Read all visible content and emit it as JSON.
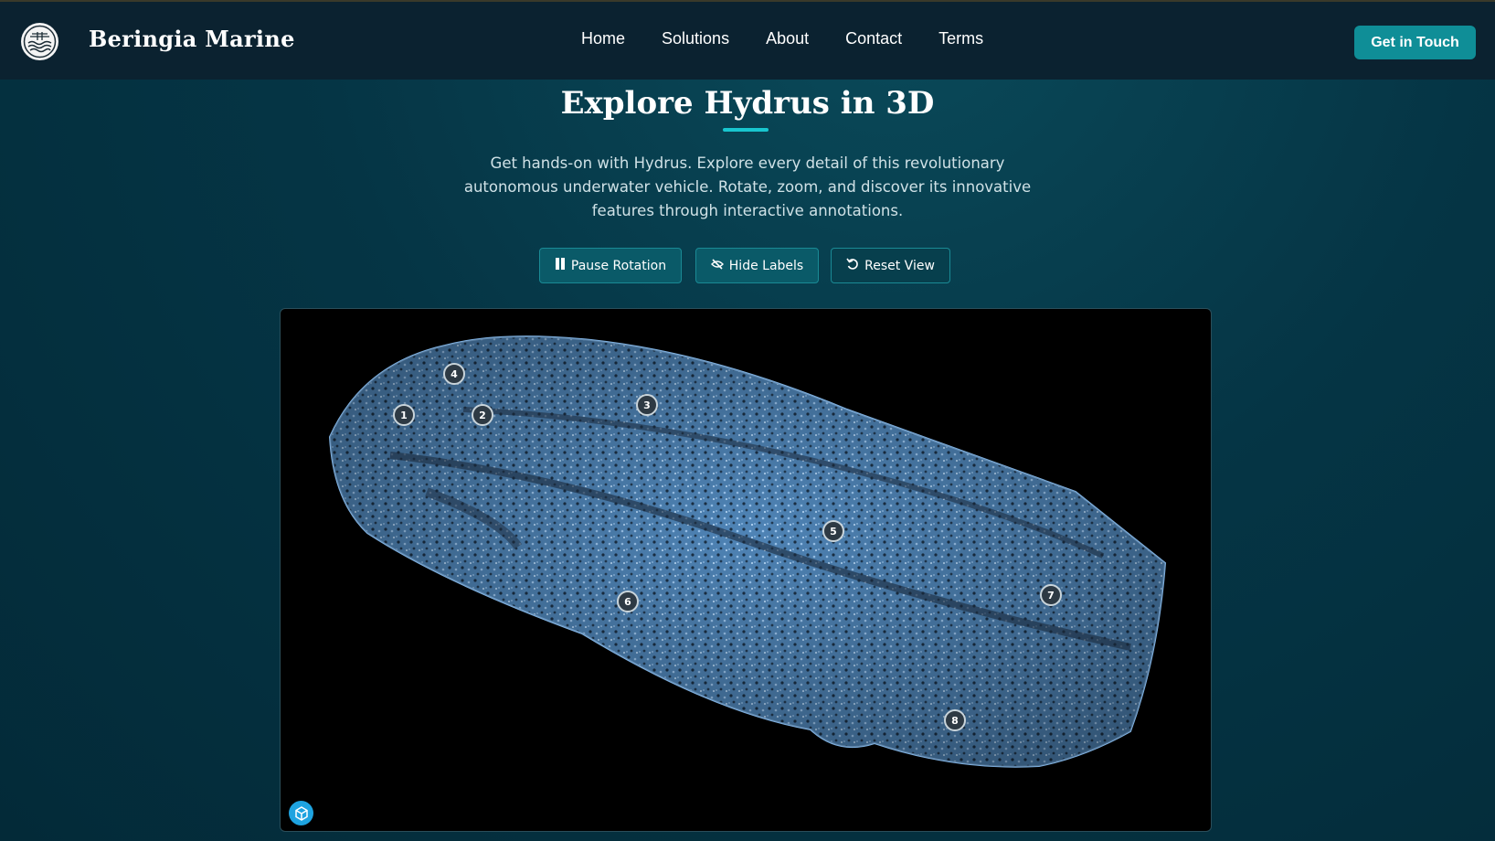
{
  "header": {
    "brand": "Beringia Marine",
    "nav": [
      "Home",
      "Solutions",
      "About",
      "Contact",
      "Terms"
    ],
    "cta": "Get in Touch",
    "logo_icon": "wave-sphere-logo-icon"
  },
  "hero": {
    "title": "Explore Hydrus in 3D",
    "description": "Get hands-on with Hydrus. Explore every detail of this revolutionary autonomous underwater vehicle. Rotate, zoom, and discover its innovative features through interactive annotations."
  },
  "controls": [
    {
      "label": "Pause Rotation",
      "icon": "pause-icon"
    },
    {
      "label": "Hide Labels",
      "icon": "eye-slash-icon"
    },
    {
      "label": "Reset View",
      "icon": "undo-icon"
    }
  ],
  "viewer": {
    "hotspots": [
      "1",
      "2",
      "3",
      "4",
      "5",
      "6",
      "7",
      "8"
    ],
    "badge_icon": "cube-icon"
  },
  "colors": {
    "accent": "#0f8e97",
    "underline": "#18c6cf",
    "header_bg": "#0b2230",
    "viewer_bg": "#000000",
    "model_blue": "#6ea6d8"
  }
}
